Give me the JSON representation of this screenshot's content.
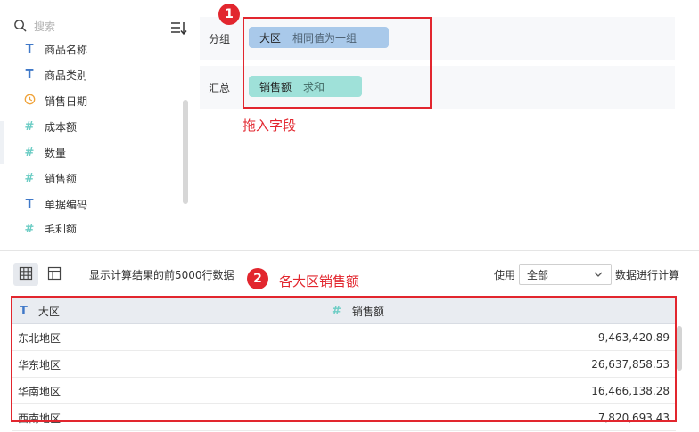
{
  "search": {
    "placeholder": "搜索"
  },
  "fields": [
    {
      "type": "text",
      "label": "商品名称"
    },
    {
      "type": "text",
      "label": "商品类别"
    },
    {
      "type": "date",
      "label": "销售日期"
    },
    {
      "type": "number",
      "label": "成本额"
    },
    {
      "type": "number",
      "label": "数量"
    },
    {
      "type": "number",
      "label": "销售额"
    },
    {
      "type": "text",
      "label": "单据编码"
    },
    {
      "type": "number",
      "label": "毛利额"
    }
  ],
  "config": {
    "group_label": "分组",
    "group_pill": {
      "name": "大区",
      "agg": "相同值为一组",
      "color": "#a9c9ea"
    },
    "summary_label": "汇总",
    "summary_pill": {
      "name": "销售额",
      "agg": "求和",
      "color": "#9fe1d9"
    }
  },
  "annotations": {
    "badge1": "1",
    "note1": "拖入字段",
    "badge2": "2",
    "note2": "各大区销售额",
    "accent": "#e2262e"
  },
  "toolbar": {
    "result_text": "显示计算结果的前5000行数据",
    "use_label": "使用",
    "select_value": "全部",
    "after_label": "数据进行计算"
  },
  "table": {
    "columns": [
      {
        "type": "text",
        "label": "大区"
      },
      {
        "type": "number",
        "label": "销售额"
      }
    ],
    "rows": [
      [
        "东北地区",
        "9,463,420.89"
      ],
      [
        "华东地区",
        "26,637,858.53"
      ],
      [
        "华南地区",
        "16,466,138.28"
      ],
      [
        "西南地区",
        "7,820,693.43"
      ]
    ]
  },
  "icons": {
    "text": "T",
    "number": "#",
    "date": "clock-icon"
  }
}
